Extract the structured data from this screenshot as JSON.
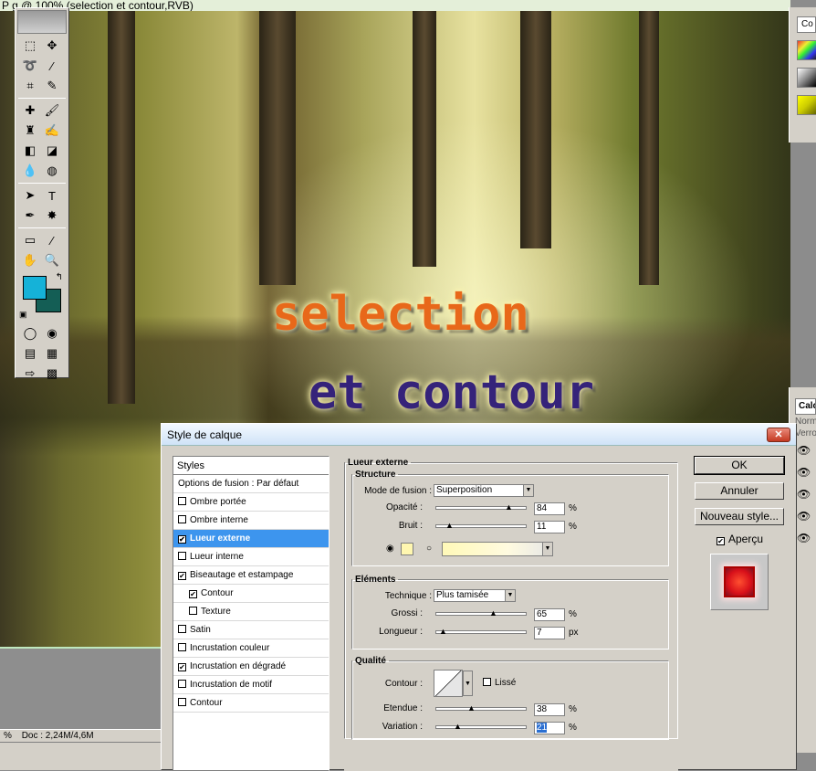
{
  "document": {
    "title": "g @ 100% (selection  et contour,RVB)",
    "title_prefix": "P",
    "canvas_text_line1": "selection",
    "canvas_text_line2": "et contour",
    "status_zoom": "%",
    "status_doc": "Doc : 2,24M/4,6M"
  },
  "colors": {
    "foreground": "#15b2d8",
    "background": "#145e55"
  },
  "right_panels": {
    "top_tab": "Co",
    "bottom_tab": "Calq",
    "bottom_mode": "Norm",
    "bottom_lock": "Verro"
  },
  "dialog": {
    "title": "Style de calque",
    "close_label": "✕",
    "styles_header": "Styles",
    "style_items": [
      {
        "label": "Options de fusion : Par défaut",
        "checkbox": false,
        "checked": false
      },
      {
        "label": "Ombre portée",
        "checkbox": true,
        "checked": false
      },
      {
        "label": "Ombre interne",
        "checkbox": true,
        "checked": false
      },
      {
        "label": "Lueur externe",
        "checkbox": true,
        "checked": true,
        "selected": true
      },
      {
        "label": "Lueur interne",
        "checkbox": true,
        "checked": false
      },
      {
        "label": "Biseautage et estampage",
        "checkbox": true,
        "checked": true
      },
      {
        "label": "Contour",
        "checkbox": true,
        "checked": true,
        "indent": true
      },
      {
        "label": "Texture",
        "checkbox": true,
        "checked": false,
        "indent": true
      },
      {
        "label": "Satin",
        "checkbox": true,
        "checked": false
      },
      {
        "label": "Incrustation couleur",
        "checkbox": true,
        "checked": false
      },
      {
        "label": "Incrustation en dégradé",
        "checkbox": true,
        "checked": true
      },
      {
        "label": "Incrustation de motif",
        "checkbox": true,
        "checked": false
      },
      {
        "label": "Contour",
        "checkbox": true,
        "checked": false
      }
    ],
    "section_title": "Lueur externe",
    "structure": {
      "legend": "Structure",
      "blend_label": "Mode de fusion :",
      "blend_value": "Superposition",
      "opacity_label": "Opacité :",
      "opacity_value": "84",
      "opacity_unit": "%",
      "opacity_fraction": 0.84,
      "noise_label": "Bruit :",
      "noise_value": "11",
      "noise_unit": "%",
      "noise_fraction": 0.11,
      "glow_color": "#fff7b0"
    },
    "elements": {
      "legend": "Eléments",
      "technique_label": "Technique :",
      "technique_value": "Plus tamisée",
      "spread_label": "Grossi :",
      "spread_value": "65",
      "spread_unit": "%",
      "spread_fraction": 0.65,
      "size_label": "Longueur :",
      "size_value": "7",
      "size_unit": "px",
      "size_fraction": 0.03
    },
    "quality": {
      "legend": "Qualité",
      "contour_label": "Contour :",
      "antialias_label": "Lissé",
      "range_label": "Etendue :",
      "range_value": "38",
      "range_unit": "%",
      "range_fraction": 0.38,
      "jitter_label": "Variation :",
      "jitter_value": "21",
      "jitter_unit": "%",
      "jitter_fraction": 0.21
    },
    "buttons": {
      "ok": "OK",
      "cancel": "Annuler",
      "new_style": "Nouveau style...",
      "preview": "Aperçu"
    }
  }
}
